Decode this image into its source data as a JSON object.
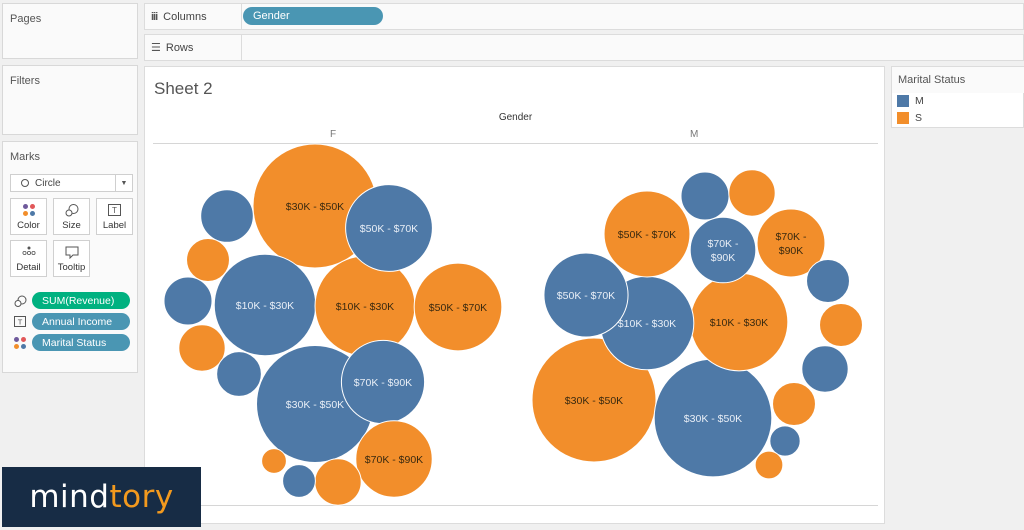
{
  "panels": {
    "pages": "Pages",
    "filters": "Filters",
    "marks": "Marks"
  },
  "shelves": {
    "columns_label": "Columns",
    "columns_pill": "Gender",
    "rows_label": "Rows"
  },
  "marks": {
    "mark_type": "Circle",
    "buttons": [
      "Color",
      "Size",
      "Label",
      "Detail",
      "Tooltip"
    ],
    "fields": [
      {
        "icon": "size-icon",
        "label": "SUM(Revenue)",
        "color": "#00b180"
      },
      {
        "icon": "label-icon",
        "label": "Annual Income",
        "color": "#4a96b3"
      },
      {
        "icon": "color-icon",
        "label": "Marital Status",
        "color": "#4a96b3"
      }
    ]
  },
  "sheet": {
    "title": "Sheet 2",
    "column_header": "Gender",
    "columns": [
      "F",
      "M"
    ]
  },
  "legend": {
    "title": "Marital Status",
    "items": [
      {
        "label": "M",
        "color": "#4e79a7"
      },
      {
        "label": "S",
        "color": "#f28e2b"
      }
    ]
  },
  "logo": {
    "part1": "mind",
    "part2": "tory"
  },
  "chart_data": {
    "type": "packed-bubble",
    "title": "Sheet 2",
    "size_measure": "SUM(Revenue)",
    "label_field": "Annual Income",
    "color_field": "Marital Status",
    "panes": [
      {
        "gender": "F",
        "bubbles": [
          {
            "status": "S",
            "label": "$30K - $50K",
            "size": 100
          },
          {
            "status": "M",
            "label": "$30K - $50K",
            "size": 89
          },
          {
            "status": "M",
            "label": "$10K - $30K",
            "size": 67
          },
          {
            "status": "S",
            "label": "$10K - $30K",
            "size": 65
          },
          {
            "status": "M",
            "label": "$50K - $70K",
            "size": 49
          },
          {
            "status": "S",
            "label": "$50K - $70K",
            "size": 50
          },
          {
            "status": "M",
            "label": "$70K - $90K",
            "size": 45
          },
          {
            "status": "S",
            "label": "$70K - $90K",
            "size": 38
          },
          {
            "status": "M",
            "label": "",
            "size": 18
          },
          {
            "status": "S",
            "label": "",
            "size": 12
          },
          {
            "status": "M",
            "label": "",
            "size": 15
          },
          {
            "status": "S",
            "label": "",
            "size": 14
          },
          {
            "status": "M",
            "label": "",
            "size": 13
          },
          {
            "status": "S",
            "label": "",
            "size": 14
          },
          {
            "status": "M",
            "label": "",
            "size": 7
          },
          {
            "status": "S",
            "label": "",
            "size": 4
          }
        ]
      },
      {
        "gender": "M",
        "bubbles": [
          {
            "status": "S",
            "label": "$30K - $50K",
            "size": 100
          },
          {
            "status": "M",
            "label": "$30K - $50K",
            "size": 90
          },
          {
            "status": "S",
            "label": "$10K - $30K",
            "size": 62
          },
          {
            "status": "M",
            "label": "$10K - $30K",
            "size": 57
          },
          {
            "status": "S",
            "label": "$50K - $70K",
            "size": 48
          },
          {
            "status": "M",
            "label": "$50K - $70K",
            "size": 46
          },
          {
            "status": "M",
            "label": "$70K - $90K",
            "size": 28
          },
          {
            "status": "S",
            "label": "$70K - $90K",
            "size": 30
          },
          {
            "status": "M",
            "label": "",
            "size": 15
          },
          {
            "status": "S",
            "label": "",
            "size": 14
          },
          {
            "status": "M",
            "label": "",
            "size": 12
          },
          {
            "status": "S",
            "label": "",
            "size": 12
          },
          {
            "status": "M",
            "label": "",
            "size": 14
          },
          {
            "status": "S",
            "label": "",
            "size": 12
          },
          {
            "status": "M",
            "label": "",
            "size": 6
          },
          {
            "status": "S",
            "label": "",
            "size": 5
          }
        ]
      }
    ]
  }
}
